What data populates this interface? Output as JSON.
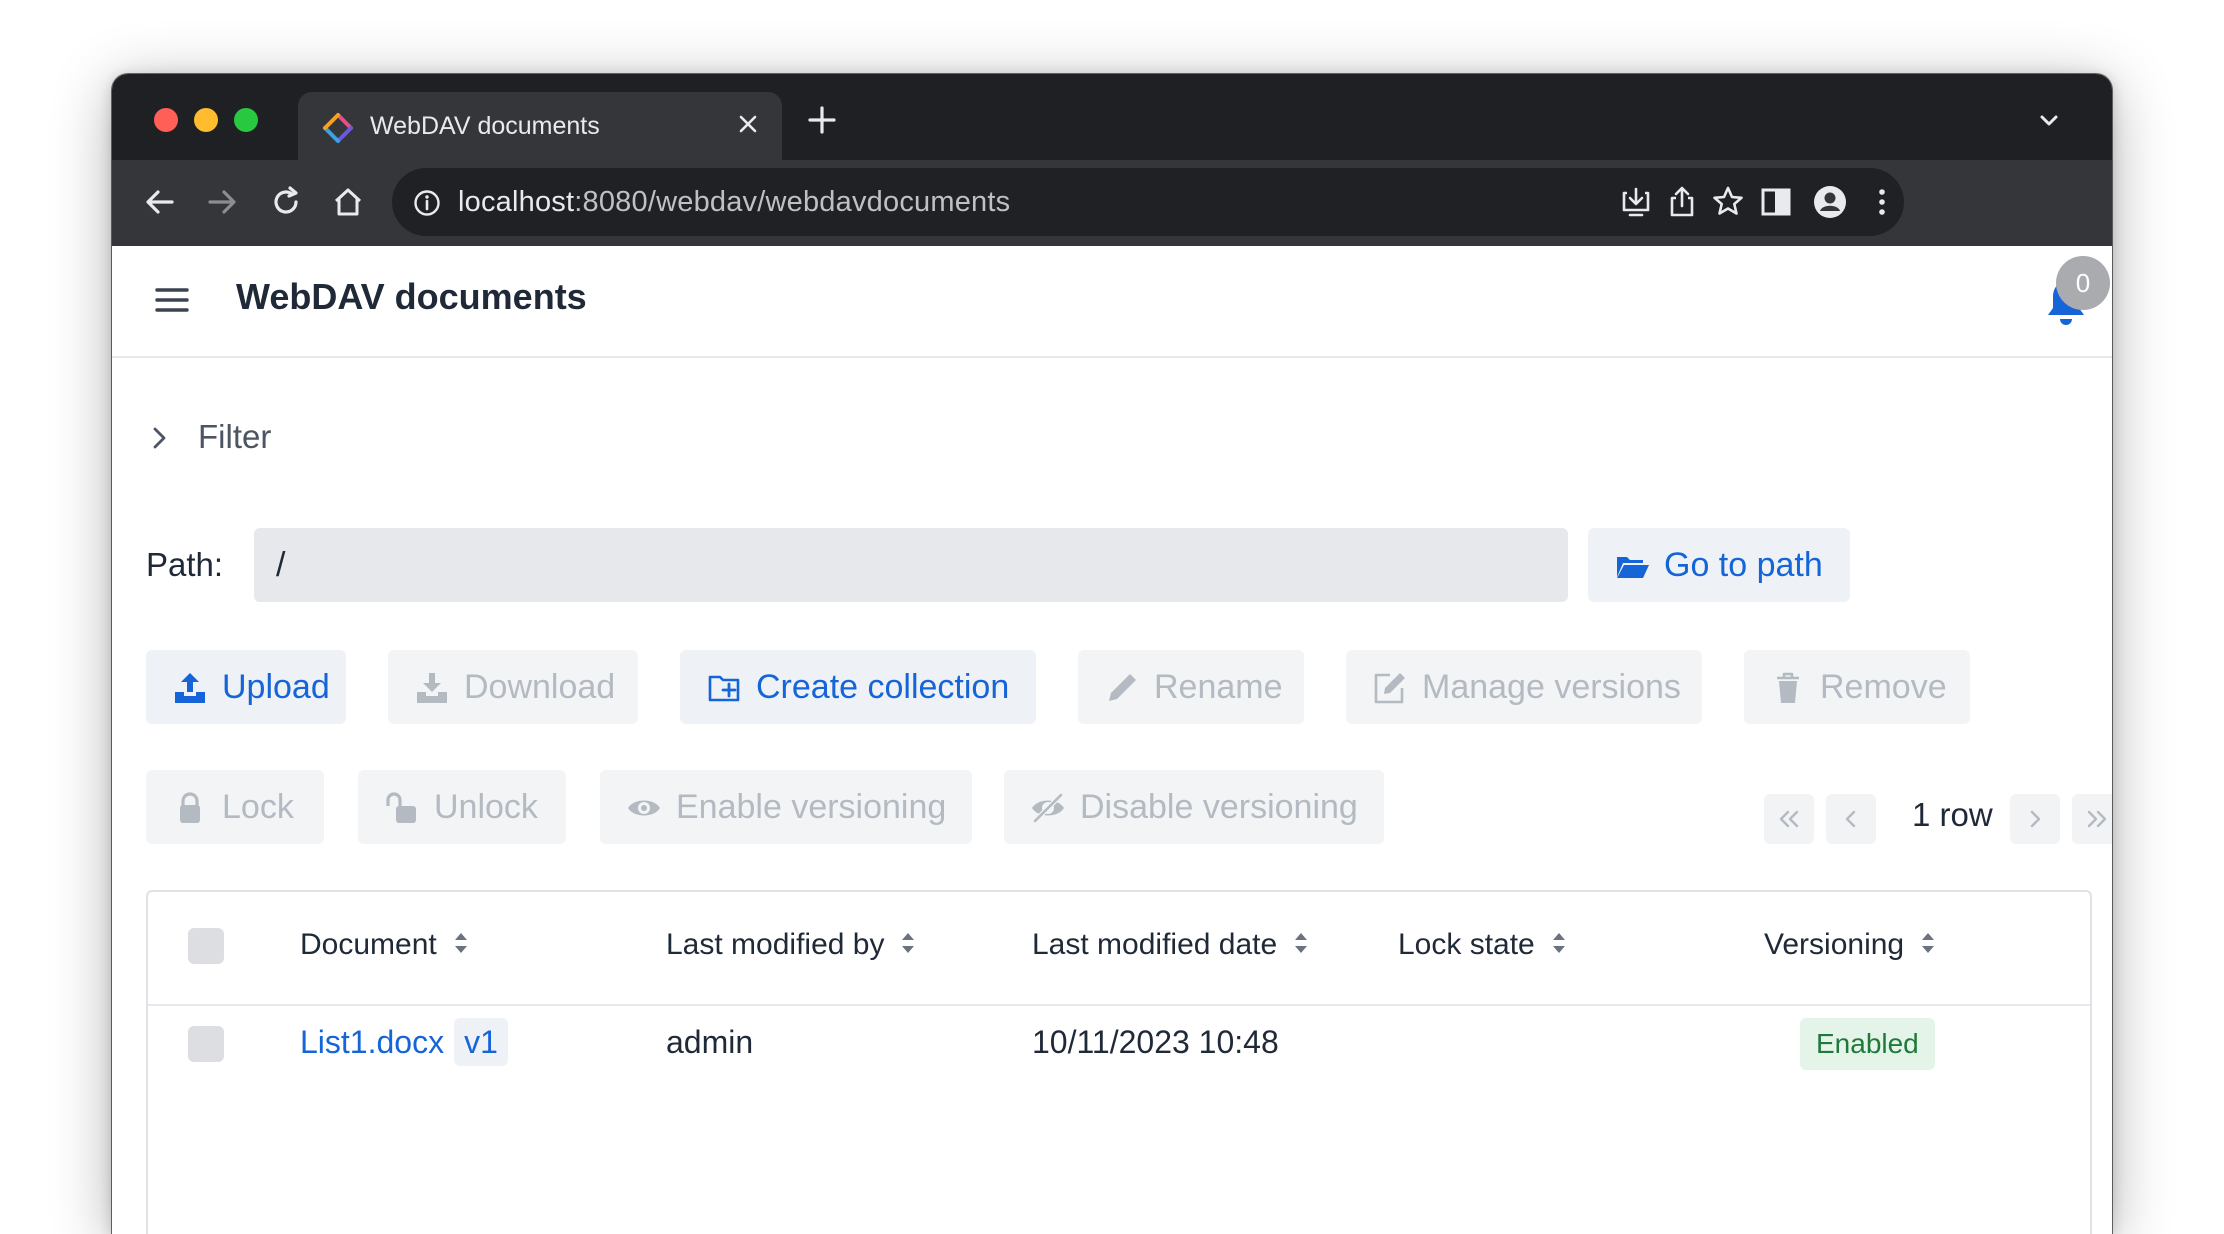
{
  "browser": {
    "tab_title": "WebDAV documents",
    "url_host": "localhost",
    "url_rest": ":8080/webdav/webdavdocuments"
  },
  "header": {
    "title": "WebDAV documents",
    "notification_count": "0"
  },
  "filter": {
    "label": "Filter"
  },
  "path": {
    "label": "Path:",
    "value": "/"
  },
  "buttons": {
    "go_to_path": "Go to path",
    "upload": "Upload",
    "download": "Download",
    "create_collection": "Create collection",
    "rename": "Rename",
    "manage_versions": "Manage versions",
    "remove": "Remove",
    "lock": "Lock",
    "unlock": "Unlock",
    "enable_versioning": "Enable versioning",
    "disable_versioning": "Disable versioning"
  },
  "pager": {
    "row_count": "1 row"
  },
  "table": {
    "columns": [
      "Document",
      "Last modified by",
      "Last modified date",
      "Lock state",
      "Versioning"
    ],
    "rows": [
      {
        "document": "List1.docx",
        "version": "v1",
        "last_modified_by": "admin",
        "last_modified_date": "10/11/2023 10:48",
        "lock_state": "",
        "versioning": "Enabled"
      }
    ]
  },
  "colors": {
    "accent": "#1565d8",
    "disabled_text": "#b4bac2",
    "enabled_badge_bg": "#e4f4e8",
    "enabled_badge_text": "#1f7a3a",
    "tab_bar": "#1f2023",
    "toolbar": "#35363a"
  }
}
